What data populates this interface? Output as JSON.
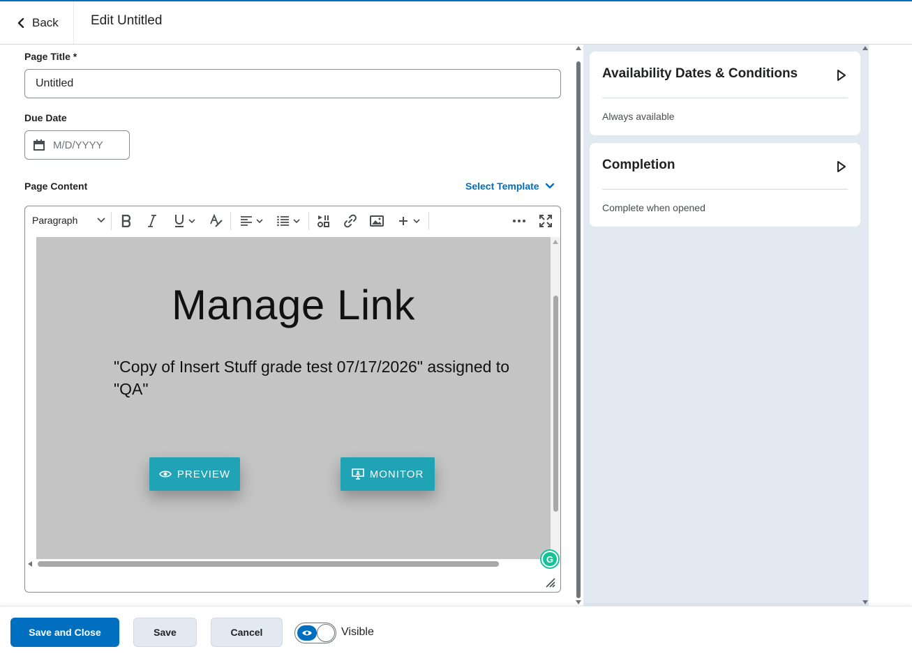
{
  "header": {
    "back_label": "Back",
    "title": "Edit Untitled"
  },
  "form": {
    "page_title_label": "Page Title *",
    "page_title_value": "Untitled",
    "due_date_label": "Due Date",
    "due_date_placeholder": "M/D/YYYY",
    "page_content_label": "Page Content",
    "select_template_label": "Select Template"
  },
  "editor": {
    "block_format": "Paragraph",
    "content": {
      "heading": "Manage Link",
      "text": "\"Copy of Insert Stuff grade test 07/17/2026\" assigned to \"QA\"",
      "preview_label": "PREVIEW",
      "monitor_label": "MONITOR",
      "button_color": "#21a3b6",
      "background": "#c4c4c4"
    },
    "toolbar_icons": [
      "bold-icon",
      "italic-icon",
      "underline-icon",
      "format-icon",
      "align-icon",
      "list-icon",
      "insert-stuff-icon",
      "link-icon",
      "image-icon",
      "add-icon",
      "more-icon",
      "fullscreen-icon"
    ]
  },
  "sidebar": {
    "availability": {
      "title": "Availability Dates & Conditions",
      "status": "Always available"
    },
    "completion": {
      "title": "Completion",
      "status": "Complete when opened"
    }
  },
  "footer": {
    "save_close_label": "Save and Close",
    "save_label": "Save",
    "cancel_label": "Cancel",
    "visibility_label": "Visible",
    "visible_on": true
  },
  "colors": {
    "primary": "#006fbf",
    "sidebar_bg": "#e3e9f1"
  }
}
